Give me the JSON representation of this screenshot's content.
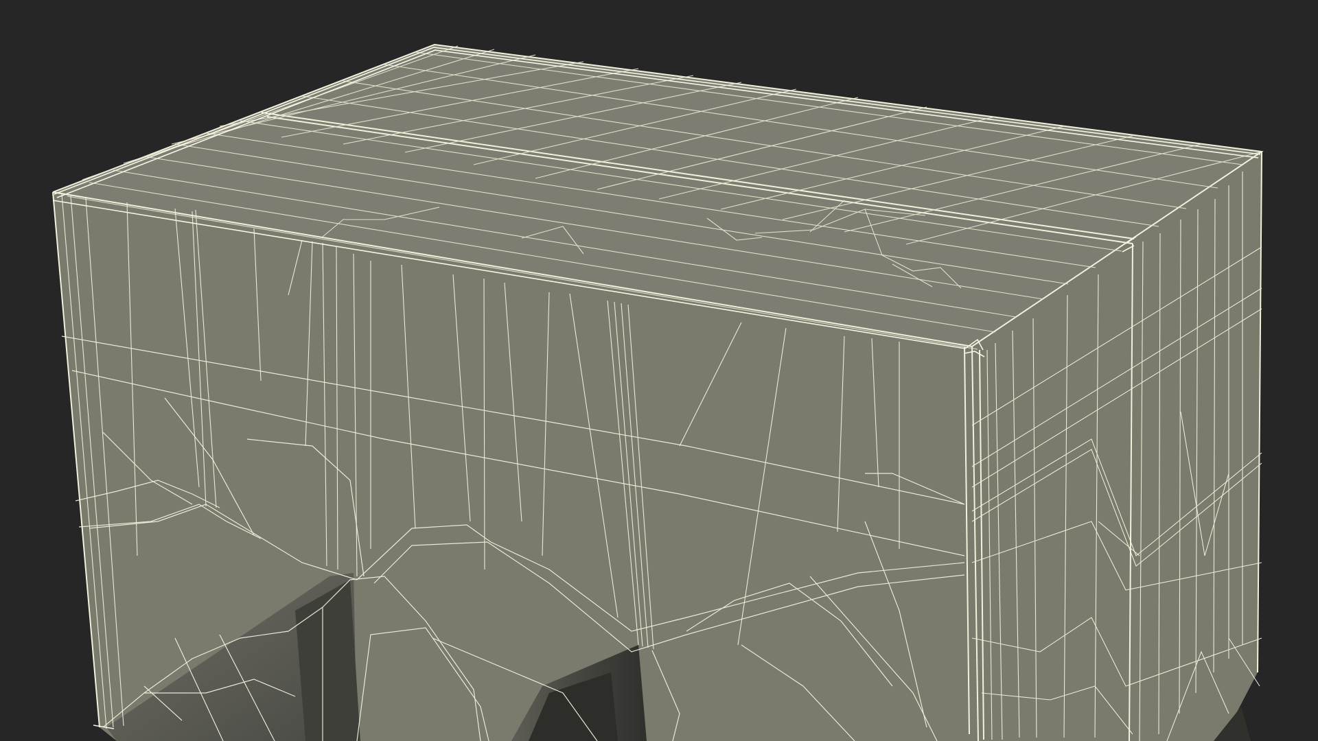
{
  "scene": {
    "background_color": "#262626",
    "surface_color": "#7a7a6d",
    "top_surface_color": "#7d7d71",
    "shadow_surface_color": "#5a5a53",
    "inner_dark_color": "#3b3b37",
    "wire_color": "#f2f1dc",
    "wire_color_soft": "#e7e5cf"
  }
}
